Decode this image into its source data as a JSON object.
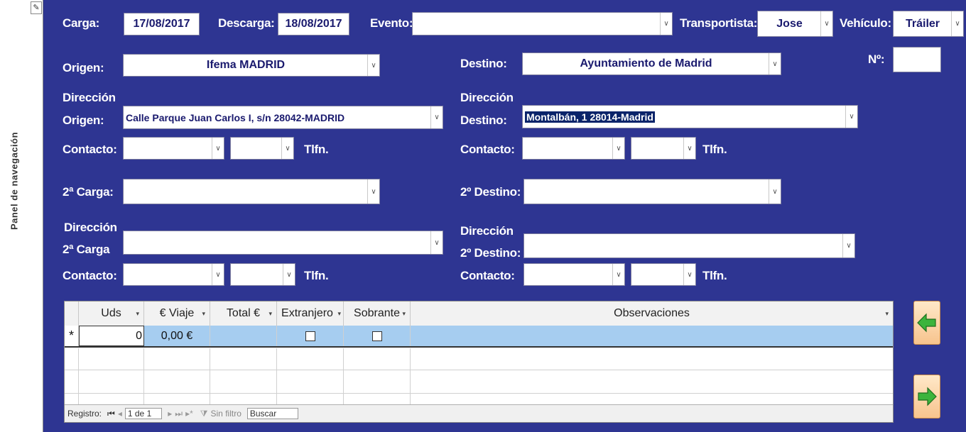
{
  "nav_pane": {
    "label": "Panel de navegación"
  },
  "header": {
    "carga_label": "Carga:",
    "carga_value": "17/08/2017",
    "descarga_label": "Descarga:",
    "descarga_value": "18/08/2017",
    "evento_label": "Evento:",
    "evento_value": "",
    "transportista_label": "Transportista:",
    "transportista_value": "Jose",
    "vehiculo_label": "Vehículo:",
    "vehiculo_value": "Tráiler",
    "numero_label": "Nº:",
    "numero_value": ""
  },
  "origen": {
    "label": "Origen:",
    "value": "Ifema MADRID",
    "direccion_label_1": "Dirección",
    "direccion_label_2": "Origen:",
    "direccion_value": "Calle Parque Juan Carlos I, s/n  28042-MADRID",
    "contacto_label": "Contacto:",
    "tlfn_label": "Tlfn."
  },
  "destino": {
    "label": "Destino:",
    "value": "Ayuntamiento de Madrid",
    "direccion_label_1": "Dirección",
    "direccion_label_2": "Destino:",
    "direccion_value": "Montalbán, 1  28014-Madrid",
    "contacto_label": "Contacto:",
    "tlfn_label": "Tlfn."
  },
  "carga2": {
    "label": "2ª Carga:",
    "value": "",
    "direccion_label_1": "Dirección",
    "direccion_label_2": "2ª Carga",
    "contacto_label": "Contacto:",
    "tlfn_label": "Tlfn."
  },
  "destino2": {
    "label": "2º Destino:",
    "value": "",
    "direccion_label_1": "Dirección",
    "direccion_label_2": "2º Destino:",
    "contacto_label": "Contacto:",
    "tlfn_label": "Tlfn."
  },
  "grid": {
    "columns": [
      "Uds",
      "€ Viaje",
      "Total €",
      "Extranjero",
      "Sobrante",
      "Observaciones"
    ],
    "new_row": {
      "marker": "*",
      "uds": "0",
      "viaje": "0,00 €"
    },
    "navbar": {
      "registro": "Registro:",
      "position": "1 de 1",
      "filter": "Sin filtro",
      "search": "Buscar"
    }
  },
  "icons": {
    "prev": "arrow-left-icon",
    "next": "arrow-right-icon",
    "dropdown": "chevron-down-icon"
  },
  "colors": {
    "form_bg": "#2e3592",
    "selected_row": "#a6cdf0",
    "arrow_green": "#3cb43c"
  }
}
